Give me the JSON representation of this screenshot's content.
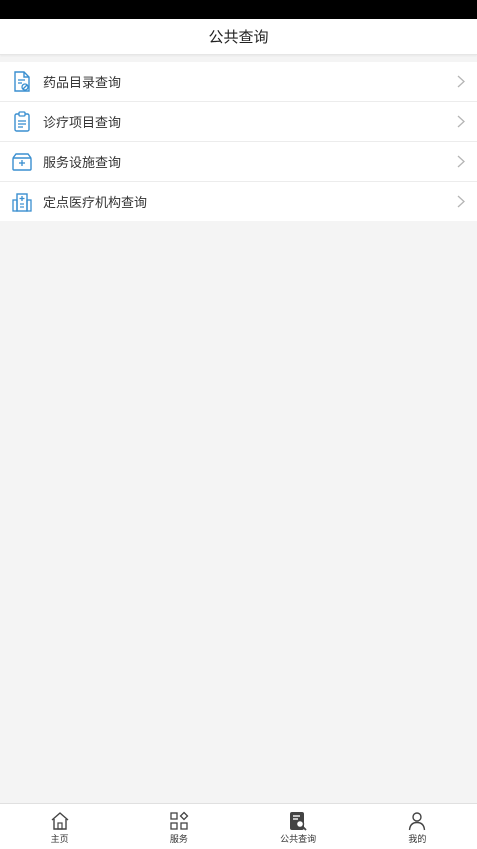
{
  "header": {
    "title": "公共查询"
  },
  "menu": {
    "items": [
      {
        "label": "药品目录查询",
        "icon": "medicine-document-icon"
      },
      {
        "label": "诊疗项目查询",
        "icon": "clipboard-icon"
      },
      {
        "label": "服务设施查询",
        "icon": "service-box-icon"
      },
      {
        "label": "定点医疗机构查询",
        "icon": "hospital-building-icon"
      }
    ]
  },
  "tabbar": {
    "items": [
      {
        "label": "主页",
        "icon": "home-icon"
      },
      {
        "label": "服务",
        "icon": "grid-icon"
      },
      {
        "label": "公共查询",
        "icon": "search-document-icon",
        "active": true
      },
      {
        "label": "我的",
        "icon": "person-icon"
      }
    ]
  },
  "colors": {
    "icon_blue": "#3a8fd0",
    "background": "#f4f4f4"
  }
}
